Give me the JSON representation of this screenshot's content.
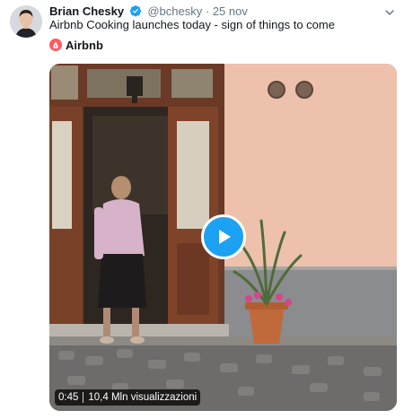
{
  "tweet": {
    "author_name": "Brian Chesky",
    "handle": "@bchesky",
    "separator": "·",
    "date": "25 nov",
    "text": "Airbnb Cooking launches today - sign of things to come"
  },
  "brand": {
    "name": "Airbnb",
    "color": "#ff5a5f"
  },
  "video": {
    "duration": "0:45",
    "views": "10,4 Mln visualizzazioni"
  },
  "colors": {
    "accent": "#1da1f2",
    "verified": "#1da1f2",
    "secondary_text": "#657786"
  },
  "icons": {
    "verified": "verified-badge-icon",
    "menu": "chevron-down-icon",
    "play": "play-icon",
    "logo": "airbnb-logo-icon"
  }
}
